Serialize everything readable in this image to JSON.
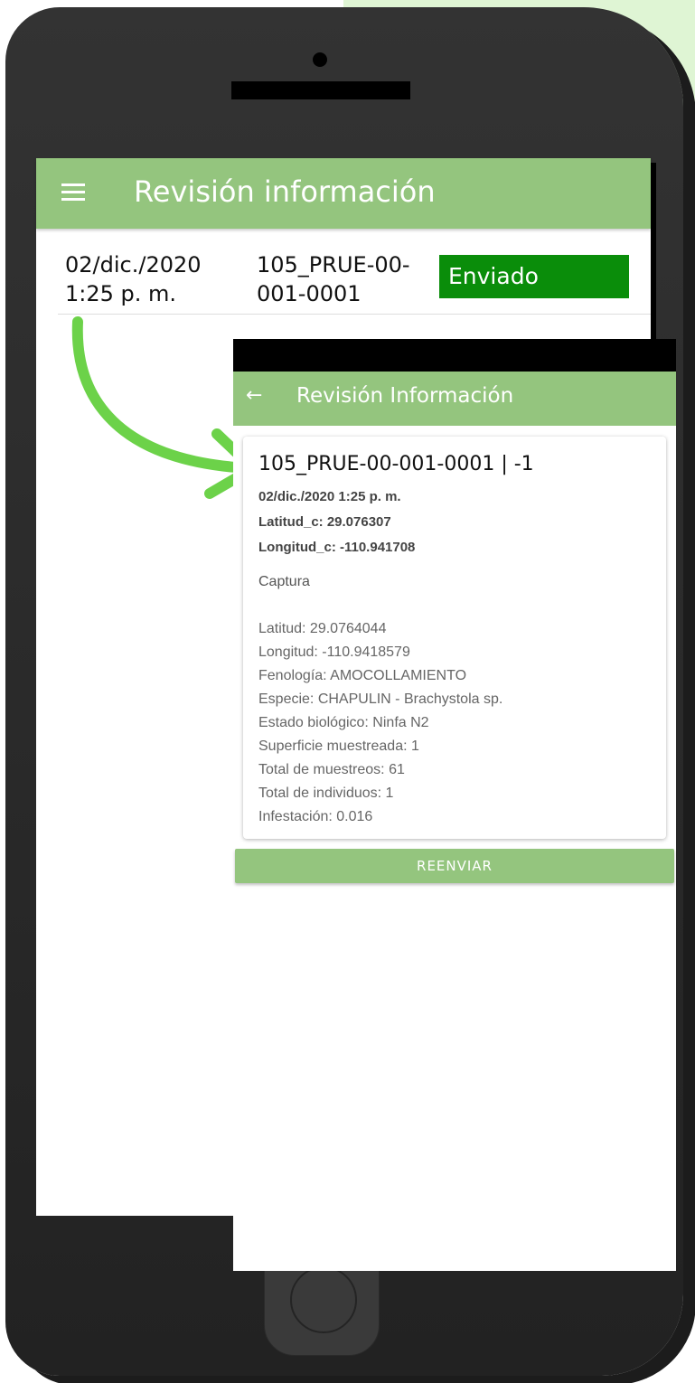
{
  "list_screen": {
    "title": "Revisión información",
    "rows": [
      {
        "date_line1": "02/dic./2020",
        "date_line2": "1:25 p. m.",
        "code_line1": "105_PRUE-00-",
        "code_line2": "001-0001",
        "status": "Enviado"
      }
    ]
  },
  "detail_screen": {
    "title": "Revisión Información",
    "card": {
      "heading": "105_PRUE-00-001-0001 | -1",
      "date": "02/dic./2020 1:25 p. m.",
      "lat_c": "Latitud_c: 29.076307",
      "lon_c": "Longitud_c: -110.941708",
      "section": "Captura",
      "details": [
        "Latitud: 29.0764044",
        "Longitud: -110.9418579",
        "Fenología: AMOCOLLAMIENTO",
        "Especie: CHAPULIN - Brachystola sp.",
        "Estado biológico: Ninfa N2",
        "Superficie muestreada: 1",
        "Total de muestreos: 61",
        "Total de individuos: 1",
        "Infestación: 0.016"
      ]
    },
    "resend_label": "REENVIAR"
  },
  "icons": {
    "menu": "menu-icon",
    "back": "back-arrow-icon",
    "pointer": "curved-arrow-icon"
  },
  "colors": {
    "appbar": "#94c57e",
    "status_badge": "#0a8d0a",
    "phone_body": "#2f2f2f",
    "arrow": "#6cd249"
  }
}
